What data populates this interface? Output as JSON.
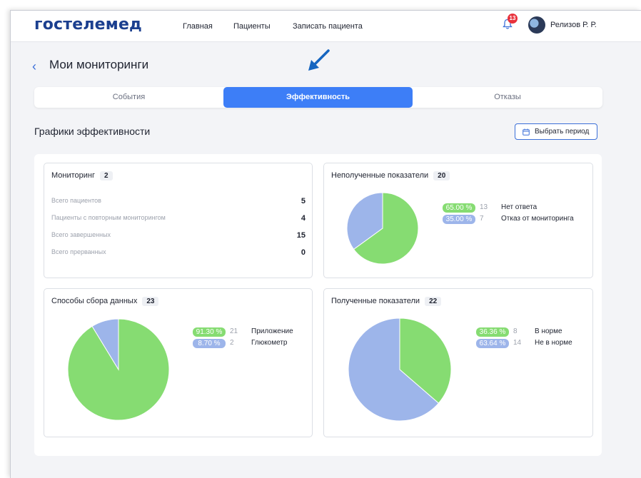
{
  "header": {
    "logo": "гостелемед",
    "nav": [
      "Главная",
      "Пациенты",
      "Записать пациента"
    ],
    "notifications_count": "13",
    "user_name": "Релизов Р. Р."
  },
  "page": {
    "back_icon": "chevron-left-icon",
    "title": "Мои мониторинги"
  },
  "tabs": [
    {
      "label": "События",
      "active": false
    },
    {
      "label": "Эффективность",
      "active": true
    },
    {
      "label": "Отказы",
      "active": false
    }
  ],
  "section": {
    "title": "Графики эффективности",
    "period_button": "Выбрать период"
  },
  "colors": {
    "green": "#86dc72",
    "blue": "#9db5ea",
    "accent": "#3d7ef7"
  },
  "monitoring": {
    "title": "Мониторинг",
    "count": "2",
    "rows": [
      {
        "label": "Всего пациентов",
        "value": "5"
      },
      {
        "label": "Пациенты с повторным мониторингом",
        "value": "4"
      },
      {
        "label": "Всего завершенных",
        "value": "15"
      },
      {
        "label": "Всего прерванных",
        "value": "0"
      }
    ]
  },
  "chart_data": [
    {
      "type": "pie",
      "title": "Неполученные показатели",
      "total": "20",
      "slices": [
        {
          "label": "Нет ответа",
          "percent": "65.00 %",
          "count": "13",
          "value": 65.0,
          "color": "#86dc72"
        },
        {
          "label": "Отказ от мониторинга",
          "percent": "35.00 %",
          "count": "7",
          "value": 35.0,
          "color": "#9db5ea"
        }
      ]
    },
    {
      "type": "pie",
      "title": "Способы сбора данных",
      "total": "23",
      "slices": [
        {
          "label": "Приложение",
          "percent": "91.30 %",
          "count": "21",
          "value": 91.3,
          "color": "#86dc72"
        },
        {
          "label": "Глюкометр",
          "percent": "8.70 %",
          "count": "2",
          "value": 8.7,
          "color": "#9db5ea"
        }
      ]
    },
    {
      "type": "pie",
      "title": "Полученные показатели",
      "total": "22",
      "slices": [
        {
          "label": "В норме",
          "percent": "36.36 %",
          "count": "8",
          "value": 36.36,
          "color": "#86dc72"
        },
        {
          "label": "Не в норме",
          "percent": "63.64 %",
          "count": "14",
          "value": 63.64,
          "color": "#9db5ea"
        }
      ]
    }
  ]
}
